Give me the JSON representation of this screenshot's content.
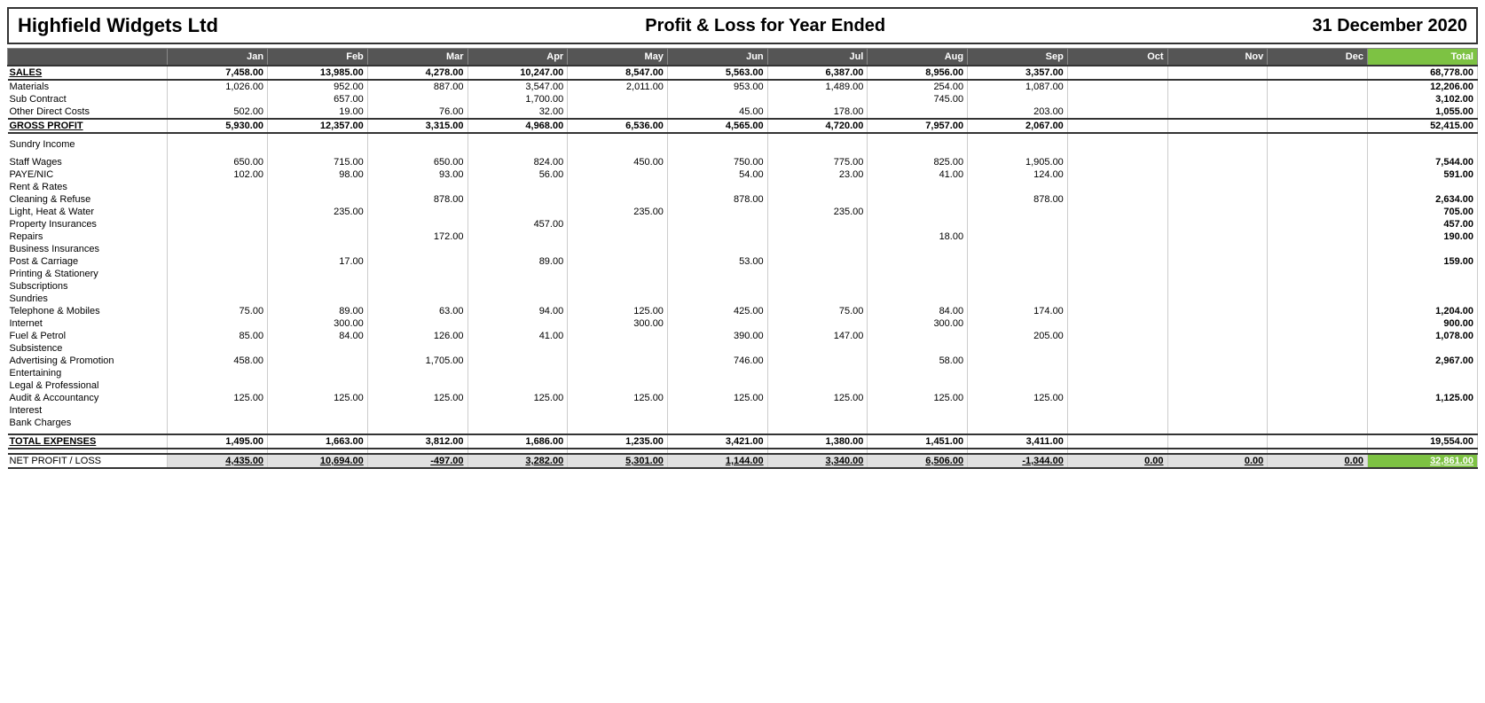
{
  "header": {
    "company": "Highfield Widgets Ltd",
    "title": "Profit & Loss for Year Ended",
    "date": "31 December 2020"
  },
  "columns": {
    "months": [
      "Jan",
      "Feb",
      "Mar",
      "Apr",
      "May",
      "Jun",
      "Jul",
      "Aug",
      "Sep",
      "Oct",
      "Nov",
      "Dec",
      "Total"
    ]
  },
  "rows": {
    "sales": {
      "label": "SALES",
      "values": [
        "7,458.00",
        "13,985.00",
        "4,278.00",
        "10,247.00",
        "8,547.00",
        "5,563.00",
        "6,387.00",
        "8,956.00",
        "3,357.00",
        "",
        "",
        "",
        "68,778.00"
      ]
    },
    "materials": {
      "label": "Materials",
      "values": [
        "1,026.00",
        "952.00",
        "887.00",
        "3,547.00",
        "2,011.00",
        "953.00",
        "1,489.00",
        "254.00",
        "1,087.00",
        "",
        "",
        "",
        "12,206.00"
      ]
    },
    "subcontract": {
      "label": "Sub Contract",
      "values": [
        "",
        "657.00",
        "",
        "1,700.00",
        "",
        "",
        "",
        "745.00",
        "",
        "",
        "",
        "",
        "3,102.00"
      ]
    },
    "other_direct": {
      "label": "Other Direct Costs",
      "values": [
        "502.00",
        "19.00",
        "76.00",
        "32.00",
        "",
        "45.00",
        "178.00",
        "",
        "203.00",
        "",
        "",
        "",
        "1,055.00"
      ]
    },
    "gross_profit": {
      "label": "GROSS PROFIT",
      "values": [
        "5,930.00",
        "12,357.00",
        "3,315.00",
        "4,968.00",
        "6,536.00",
        "4,565.00",
        "4,720.00",
        "7,957.00",
        "2,067.00",
        "",
        "",
        "",
        "52,415.00"
      ]
    },
    "sundry_income": {
      "label": "Sundry Income",
      "values": [
        "",
        "",
        "",
        "",
        "",
        "",
        "",
        "",
        "",
        "",
        "",
        "",
        ""
      ]
    },
    "staff_wages": {
      "label": "Staff Wages",
      "values": [
        "650.00",
        "715.00",
        "650.00",
        "824.00",
        "450.00",
        "750.00",
        "775.00",
        "825.00",
        "1,905.00",
        "",
        "",
        "",
        "7,544.00"
      ]
    },
    "paye_nic": {
      "label": "PAYE/NIC",
      "values": [
        "102.00",
        "98.00",
        "93.00",
        "56.00",
        "",
        "54.00",
        "23.00",
        "41.00",
        "124.00",
        "",
        "",
        "",
        "591.00"
      ]
    },
    "rent_rates": {
      "label": "Rent & Rates",
      "values": [
        "",
        "",
        "",
        "",
        "",
        "",
        "",
        "",
        "",
        "",
        "",
        "",
        ""
      ]
    },
    "cleaning": {
      "label": "Cleaning & Refuse",
      "values": [
        "",
        "",
        "878.00",
        "",
        "",
        "878.00",
        "",
        "",
        "878.00",
        "",
        "",
        "",
        "2,634.00"
      ]
    },
    "light_heat": {
      "label": "Light, Heat & Water",
      "values": [
        "",
        "235.00",
        "",
        "",
        "235.00",
        "",
        "235.00",
        "",
        "",
        "",
        "",
        "",
        "705.00"
      ]
    },
    "property_ins": {
      "label": "Property Insurances",
      "values": [
        "",
        "",
        "",
        "457.00",
        "",
        "",
        "",
        "",
        "",
        "",
        "",
        "",
        "457.00"
      ]
    },
    "repairs": {
      "label": "Repairs",
      "values": [
        "",
        "",
        "172.00",
        "",
        "",
        "",
        "",
        "18.00",
        "",
        "",
        "",
        "",
        "190.00"
      ]
    },
    "business_ins": {
      "label": "Business Insurances",
      "values": [
        "",
        "",
        "",
        "",
        "",
        "",
        "",
        "",
        "",
        "",
        "",
        "",
        ""
      ]
    },
    "post_carriage": {
      "label": "Post & Carriage",
      "values": [
        "",
        "17.00",
        "",
        "89.00",
        "",
        "53.00",
        "",
        "",
        "",
        "",
        "",
        "",
        "159.00"
      ]
    },
    "printing": {
      "label": "Printing & Stationery",
      "values": [
        "",
        "",
        "",
        "",
        "",
        "",
        "",
        "",
        "",
        "",
        "",
        "",
        ""
      ]
    },
    "subscriptions": {
      "label": "Subscriptions",
      "values": [
        "",
        "",
        "",
        "",
        "",
        "",
        "",
        "",
        "",
        "",
        "",
        "",
        ""
      ]
    },
    "sundries": {
      "label": "Sundries",
      "values": [
        "",
        "",
        "",
        "",
        "",
        "",
        "",
        "",
        "",
        "",
        "",
        "",
        ""
      ]
    },
    "telephone": {
      "label": "Telephone & Mobiles",
      "values": [
        "75.00",
        "89.00",
        "63.00",
        "94.00",
        "125.00",
        "425.00",
        "75.00",
        "84.00",
        "174.00",
        "",
        "",
        "",
        "1,204.00"
      ]
    },
    "internet": {
      "label": "Internet",
      "values": [
        "",
        "300.00",
        "",
        "",
        "300.00",
        "",
        "",
        "300.00",
        "",
        "",
        "",
        "",
        "900.00"
      ]
    },
    "fuel_petrol": {
      "label": "Fuel & Petrol",
      "values": [
        "85.00",
        "84.00",
        "126.00",
        "41.00",
        "",
        "390.00",
        "147.00",
        "",
        "205.00",
        "",
        "",
        "",
        "1,078.00"
      ]
    },
    "subsistence": {
      "label": "Subsistence",
      "values": [
        "",
        "",
        "",
        "",
        "",
        "",
        "",
        "",
        "",
        "",
        "",
        "",
        ""
      ]
    },
    "advertising": {
      "label": "Advertising & Promotion",
      "values": [
        "458.00",
        "",
        "1,705.00",
        "",
        "",
        "746.00",
        "",
        "58.00",
        "",
        "",
        "",
        "",
        "2,967.00"
      ]
    },
    "entertaining": {
      "label": "Entertaining",
      "values": [
        "",
        "",
        "",
        "",
        "",
        "",
        "",
        "",
        "",
        "",
        "",
        "",
        ""
      ]
    },
    "legal_prof": {
      "label": "Legal & Professional",
      "values": [
        "",
        "",
        "",
        "",
        "",
        "",
        "",
        "",
        "",
        "",
        "",
        "",
        ""
      ]
    },
    "audit": {
      "label": "Audit & Accountancy",
      "values": [
        "125.00",
        "125.00",
        "125.00",
        "125.00",
        "125.00",
        "125.00",
        "125.00",
        "125.00",
        "125.00",
        "",
        "",
        "",
        "1,125.00"
      ]
    },
    "interest": {
      "label": "Interest",
      "values": [
        "",
        "",
        "",
        "",
        "",
        "",
        "",
        "",
        "",
        "",
        "",
        "",
        ""
      ]
    },
    "bank_charges": {
      "label": "Bank Charges",
      "values": [
        "",
        "",
        "",
        "",
        "",
        "",
        "",
        "",
        "",
        "",
        "",
        "",
        ""
      ]
    },
    "total_expenses": {
      "label": "TOTAL EXPENSES",
      "values": [
        "1,495.00",
        "1,663.00",
        "3,812.00",
        "1,686.00",
        "1,235.00",
        "3,421.00",
        "1,380.00",
        "1,451.00",
        "3,411.00",
        "",
        "",
        "",
        "19,554.00"
      ]
    },
    "net_profit": {
      "label": "NET PROFIT / LOSS",
      "values": [
        "4,435.00",
        "10,694.00",
        "-497.00",
        "3,282.00",
        "5,301.00",
        "1,144.00",
        "3,340.00",
        "6,506.00",
        "-1,344.00",
        "0.00",
        "0.00",
        "0.00",
        "32,861.00"
      ]
    }
  }
}
